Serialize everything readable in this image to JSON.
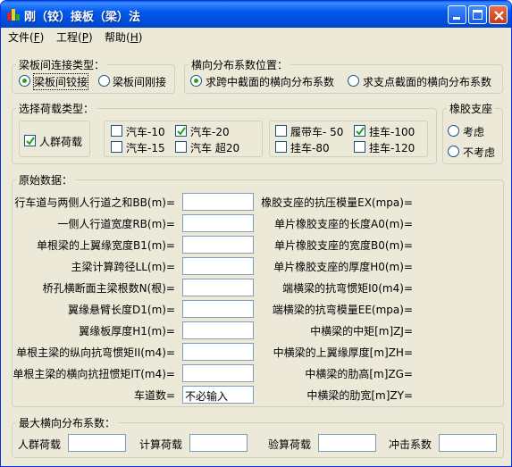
{
  "window": {
    "title": "刚（铰）接板（梁）法"
  },
  "menu": [
    {
      "label": "文件",
      "key": "F"
    },
    {
      "label": "工程",
      "key": "P"
    },
    {
      "label": "帮助",
      "key": "H"
    }
  ],
  "connection": {
    "legend": "梁板间连接类型：",
    "options": [
      "梁板间铰接",
      "梁板间刚接"
    ],
    "selected": "梁板间铰接"
  },
  "position": {
    "legend": "横向分布系数位置：",
    "options": [
      "求跨中截面的横向分布系数",
      "求支点截面的横向分布系数"
    ],
    "selected": "求跨中截面的横向分布系数"
  },
  "loads": {
    "legend": "选择荷载类型：",
    "crowd": {
      "label": "人群荷载",
      "checked": true
    },
    "cars": [
      {
        "label": "汽车-10",
        "checked": false
      },
      {
        "label": "汽车-20",
        "checked": true
      },
      {
        "label": "汽车-15",
        "checked": false
      },
      {
        "label": "汽车 超20",
        "checked": false
      }
    ],
    "heavy": [
      {
        "label": "履带车- 50",
        "checked": false
      },
      {
        "label": "挂车-100",
        "checked": true
      },
      {
        "label": "挂车-80",
        "checked": false
      },
      {
        "label": "挂车-120",
        "checked": false
      }
    ]
  },
  "bearing": {
    "legend": "橡胶支座",
    "options": [
      "考虑",
      "不考虑"
    ],
    "selected": null
  },
  "raw": {
    "legend": "原始数据：",
    "left_fields": [
      {
        "label": "行车道与两侧人行道之和BB(m)=",
        "value": ""
      },
      {
        "label": "一侧人行道宽度RB(m)=",
        "value": ""
      },
      {
        "label": "单根梁的上翼缘宽度B1(m)=",
        "value": ""
      },
      {
        "label": "主梁计算跨径LL(m)=",
        "value": ""
      },
      {
        "label": "桥孔横断面主梁根数N(根)=",
        "value": ""
      },
      {
        "label": "翼缘悬臂长度D1(m)=",
        "value": ""
      },
      {
        "label": "翼缘板厚度H1(m)=",
        "value": ""
      },
      {
        "label": "单根主梁的纵向抗弯惯矩II(m4)=",
        "value": ""
      },
      {
        "label": "单根主梁的横向抗扭惯矩IT(m4)=",
        "value": ""
      },
      {
        "label": "车道数=",
        "value": "不必输入"
      }
    ],
    "right_fields": [
      {
        "label": "橡胶支座的抗压模量EX(mpa)="
      },
      {
        "label": "单片橡胶支座的长度A0(m)="
      },
      {
        "label": "单片橡胶支座的宽度B0(m)="
      },
      {
        "label": "单片橡胶支座的厚度H0(m)="
      },
      {
        "label": "端横梁的抗弯惯矩I0(m4)="
      },
      {
        "label": "端横梁的抗弯模量EE(mpa)="
      },
      {
        "label": "中横梁的中矩[m]ZJ="
      },
      {
        "label": "中横梁的上翼缘厚度[m]ZH="
      },
      {
        "label": "中横梁的肋高[m]ZG="
      },
      {
        "label": "中横梁的肋宽[m]ZY="
      }
    ]
  },
  "results": {
    "legend": "最大横向分布系数：",
    "fields": [
      {
        "label": "人群荷载",
        "value": ""
      },
      {
        "label": "计算荷载",
        "value": ""
      },
      {
        "label": "验算荷载",
        "value": ""
      },
      {
        "label": "冲击系数",
        "value": ""
      }
    ]
  }
}
